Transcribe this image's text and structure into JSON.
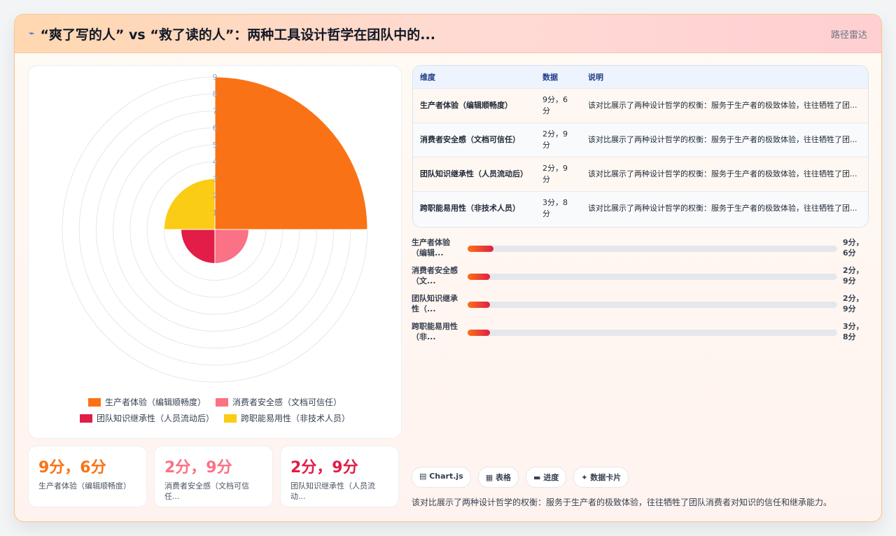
{
  "header": {
    "icon": "lightning-icon",
    "title": "“爽了写的人” vs “救了读的人”：两种工具设计哲学在团队中的...",
    "chart_type_label": "路径雷达"
  },
  "chart_data": {
    "type": "polarArea",
    "categories": [
      "生产者体验（编辑顺畅度）",
      "消费者安全感（文档可信任）",
      "团队知识继承性（人员流动后）",
      "跨职能易用性（非技术人员）"
    ],
    "values": [
      9,
      2,
      2,
      3
    ],
    "colors": [
      "#f97316",
      "#fb7185",
      "#e11d48",
      "#facc15"
    ],
    "rlim": [
      0,
      9
    ],
    "ticks": [
      "1",
      "2",
      "3",
      "4",
      "5",
      "6",
      "7",
      "8",
      "9"
    ],
    "grid": true,
    "legend": "bottom"
  },
  "kpis": [
    {
      "value": "9分，6分",
      "label": "生产者体验（编辑顺畅度）",
      "color": "#f97316"
    },
    {
      "value": "2分，9分",
      "label": "消费者安全感（文档可信任...",
      "color": "#fb7185"
    },
    {
      "value": "2分，9分",
      "label": "团队知识继承性（人员流动...",
      "color": "#e11d48"
    }
  ],
  "table": {
    "headers": [
      "维度",
      "数据",
      "说明"
    ],
    "rows": [
      {
        "dim": "生产者体验（编辑顺畅度）",
        "data": "9分，6分",
        "note": "该对比展示了两种设计哲学的权衡：服务于生产者的极致体验，往往牺牲了团..."
      },
      {
        "dim": "消费者安全感（文档可信任）",
        "data": "2分，9分",
        "note": "该对比展示了两种设计哲学的权衡：服务于生产者的极致体验，往往牺牲了团..."
      },
      {
        "dim": "团队知识继承性（人员流动后）",
        "data": "2分，9分",
        "note": "该对比展示了两种设计哲学的权衡：服务于生产者的极致体验，往往牺牲了团..."
      },
      {
        "dim": "跨职能易用性（非技术人员）",
        "data": "3分，8分",
        "note": "该对比展示了两种设计哲学的权衡：服务于生产者的极致体验，往往牺牲了团..."
      }
    ]
  },
  "bars": [
    {
      "label": "生产者体验（编辑...",
      "value": "9分，6分",
      "progress": 0.07
    },
    {
      "label": "消费者安全感（文...",
      "value": "2分，9分",
      "progress": 0.06
    },
    {
      "label": "团队知识继承性（...",
      "value": "2分，9分",
      "progress": 0.06
    },
    {
      "label": "跨职能易用性（非...",
      "value": "3分，8分",
      "progress": 0.06
    }
  ],
  "tags": [
    {
      "label": "Chart.js",
      "icon": "monitor-icon",
      "glyph": "▤"
    },
    {
      "label": "表格",
      "icon": "table-icon",
      "glyph": "▦"
    },
    {
      "label": "进度",
      "icon": "progress-icon",
      "glyph": "▬"
    },
    {
      "label": "数据卡片",
      "icon": "sparkle-icon",
      "glyph": "✦"
    }
  ],
  "summary": "该对比展示了两种设计哲学的权衡：服务于生产者的极致体验，往往牺牲了团队消费者对知识的信任和继承能力。"
}
